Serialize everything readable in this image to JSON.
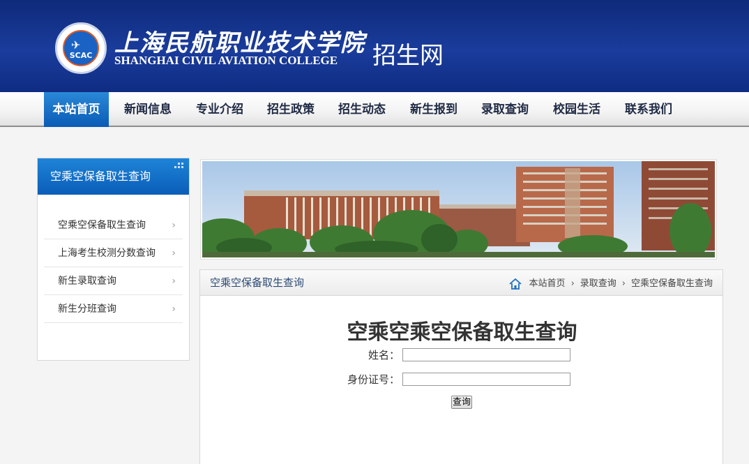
{
  "header": {
    "logo_text": "SCAC",
    "college_name_cn": "上海民航职业技术学院",
    "college_name_en": "SHANGHAI CIVIL AVIATION COLLEGE",
    "site_name": "招生网"
  },
  "nav": {
    "items": [
      {
        "label": "本站首页",
        "active": true
      },
      {
        "label": "新闻信息"
      },
      {
        "label": "专业介绍"
      },
      {
        "label": "招生政策"
      },
      {
        "label": "招生动态"
      },
      {
        "label": "新生报到"
      },
      {
        "label": "录取查询"
      },
      {
        "label": "校园生活"
      },
      {
        "label": "联系我们"
      }
    ]
  },
  "sidebar": {
    "title": "空乘空保备取生查询",
    "items": [
      {
        "label": "空乘空保备取生查询"
      },
      {
        "label": "上海考生校测分数查询"
      },
      {
        "label": "新生录取查询"
      },
      {
        "label": "新生分班查询"
      }
    ]
  },
  "panel": {
    "title": "空乘空保备取生查询",
    "breadcrumb": [
      "本站首页",
      "录取查询",
      "空乘空保备取生查询"
    ],
    "query_title": "空乘空乘空保备取生查询",
    "name_label": "姓名：",
    "id_label": "身份证号：",
    "name_value": "",
    "id_value": "",
    "submit_label": "查询"
  },
  "colors": {
    "header_blue": "#1a3c9c",
    "nav_active": "#0a5bb5",
    "sidebar_head": "#1e84d8"
  }
}
